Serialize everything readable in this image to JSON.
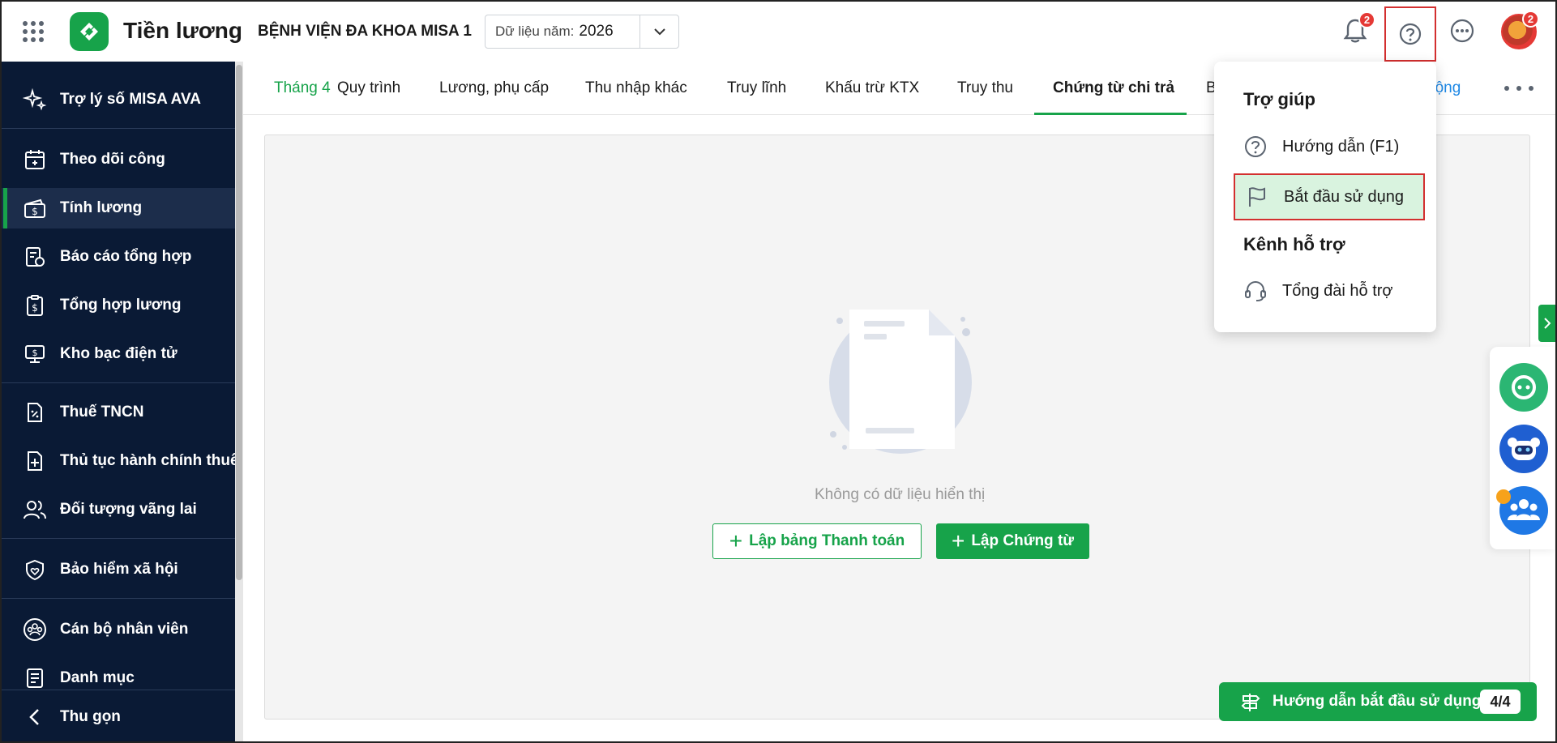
{
  "header": {
    "app_title": "Tiền lương",
    "org_name": "BỆNH VIỆN ĐA KHOA MISA 1",
    "year_label": "Dữ liệu năm:",
    "year_value": "2026",
    "notification_count": "2",
    "avatar_count": "2"
  },
  "sidebar": {
    "items": [
      {
        "label": "Trợ lý số MISA AVA",
        "icon": "sparkle-icon"
      },
      {
        "label": "Theo dõi công",
        "icon": "calendar-icon"
      },
      {
        "label": "Tính lương",
        "icon": "money-icon"
      },
      {
        "label": "Báo cáo tổng hợp",
        "icon": "report-icon"
      },
      {
        "label": "Tổng hợp lương",
        "icon": "clipboard-money-icon"
      },
      {
        "label": "Kho bạc điện tử",
        "icon": "treasury-icon"
      },
      {
        "label": "Thuế TNCN",
        "icon": "tax-icon"
      },
      {
        "label": "Thủ tục hành chính thuế",
        "icon": "document-plus-icon"
      },
      {
        "label": "Đối tượng vãng lai",
        "icon": "users-icon"
      },
      {
        "label": "Bảo hiểm xã hội",
        "icon": "shield-heart-icon"
      },
      {
        "label": "Cán bộ nhân viên",
        "icon": "team-icon"
      },
      {
        "label": "Danh mục",
        "icon": "list-icon"
      }
    ],
    "collapse_label": "Thu gọn"
  },
  "tabs": {
    "month": "Tháng 4",
    "items": [
      "Quy trình",
      "Lương, phụ cấp",
      "Thu nhập khác",
      "Truy lĩnh",
      "Khấu trừ KTX",
      "Truy thu",
      "Chứng từ chi trả",
      "B",
      "động"
    ],
    "active": "Chứng từ chi trả"
  },
  "content": {
    "empty_text": "Không có dữ liệu hiển thị",
    "btn_payment": "Lập bảng Thanh toán",
    "btn_voucher": "Lập Chứng từ"
  },
  "help_popup": {
    "title": "Trợ giúp",
    "guide": "Hướng dẫn (F1)",
    "start": "Bắt đầu sử dụng",
    "support_title": "Kênh hỗ trợ",
    "hotline": "Tổng đài hỗ trợ"
  },
  "guide_button": {
    "label": "Hướng dẫn bắt đầu sử dụng",
    "progress": "4/4"
  },
  "colors": {
    "brand_green": "#17a34a",
    "sidebar_bg": "#0a1a35",
    "highlight_red": "#d32f2f"
  }
}
